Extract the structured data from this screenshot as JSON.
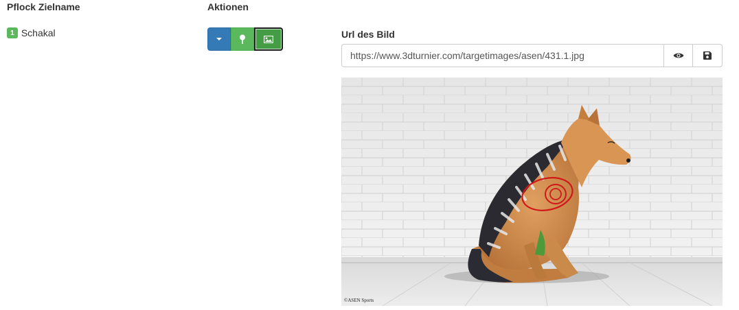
{
  "table": {
    "columns": {
      "stake_target": "Pflock Zielname",
      "actions": "Aktionen"
    },
    "row": {
      "stake_number": "1",
      "target_name": "Schakal"
    }
  },
  "actions": {
    "dropdown_icon": "caret-down-icon",
    "pin_icon": "map-marker-icon",
    "image_icon": "picture-icon"
  },
  "image_panel": {
    "label": "Url des Bild",
    "url_value": "https://www.3dturnier.com/targetimages/asen/431.1.jpg",
    "view_icon": "eye-icon",
    "save_icon": "floppy-disk-icon",
    "image_credit": "©ASEN Sports"
  },
  "colors": {
    "primary": "#337ab7",
    "success": "#5cb85c",
    "success_active": "#449d44"
  }
}
